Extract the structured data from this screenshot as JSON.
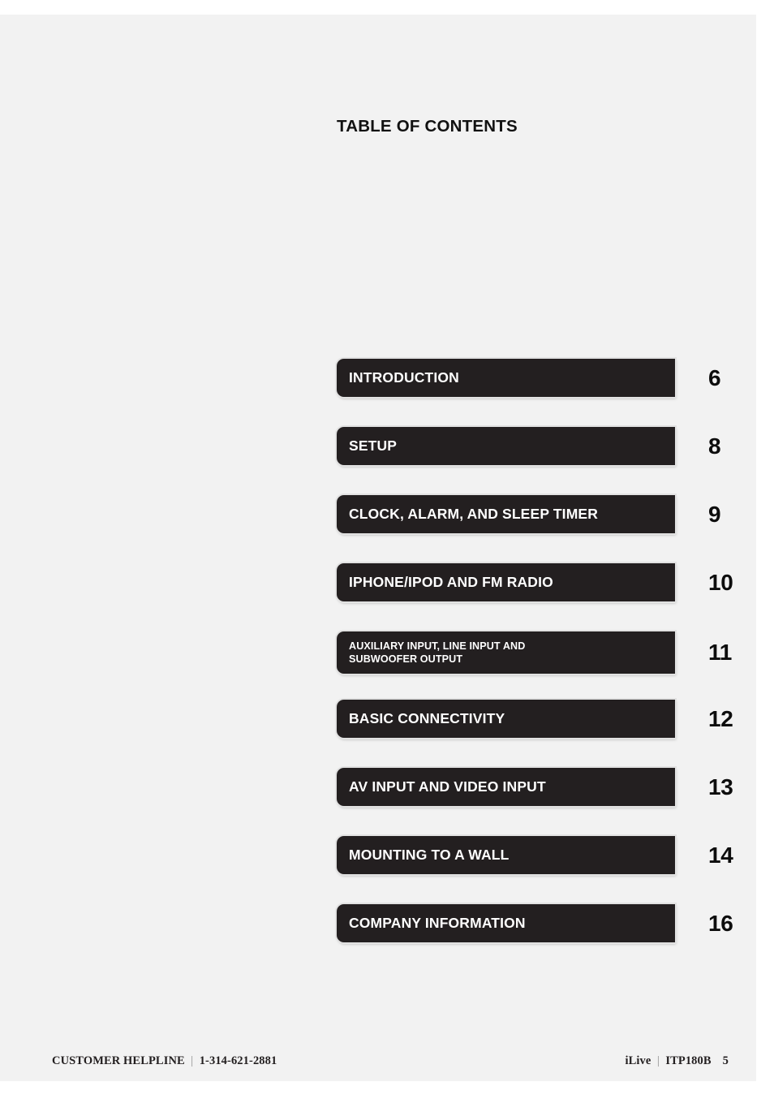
{
  "page": {
    "background_color": "#f2f2f2",
    "sheet_color": "#ffffff"
  },
  "heading": {
    "title": "TABLE OF CONTENTS"
  },
  "contents": {
    "bar_color": "#231f20",
    "bar_text_color": "#ffffff",
    "entries": [
      {
        "label": "INTRODUCTION",
        "page": "6",
        "lines": 1
      },
      {
        "label": "SETUP",
        "page": "8",
        "lines": 1
      },
      {
        "label": "CLOCK, ALARM, AND SLEEP TIMER",
        "page": "9",
        "lines": 1
      },
      {
        "label": "IPHONE/IPOD AND FM RADIO",
        "page": "10",
        "lines": 1
      },
      {
        "label": "AUXILIARY INPUT, LINE INPUT AND\nSUBWOOFER OUTPUT",
        "page": "11",
        "lines": 2
      },
      {
        "label": "BASIC CONNECTIVITY",
        "page": "12",
        "lines": 1
      },
      {
        "label": "AV INPUT AND VIDEO INPUT",
        "page": "13",
        "lines": 1
      },
      {
        "label": "MOUNTING TO A WALL",
        "page": "14",
        "lines": 1
      },
      {
        "label": "COMPANY INFORMATION",
        "page": "16",
        "lines": 1
      }
    ]
  },
  "footer": {
    "helpline_label": "CUSTOMER HELPLINE",
    "separator": "|",
    "helpline_number": "1-314-621-2881",
    "brand": "iLive",
    "model": "ITP180B",
    "page_number": "5"
  }
}
